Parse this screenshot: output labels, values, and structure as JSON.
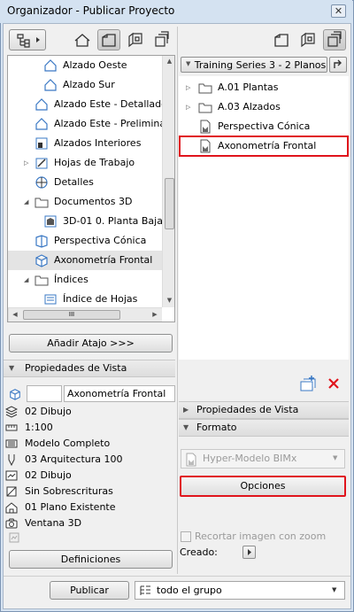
{
  "window": {
    "title": "Organizador - Publicar Proyecto",
    "close": "✕"
  },
  "left_tree": {
    "items": [
      {
        "label": "Alzado Oeste",
        "icon": "elevation-icon"
      },
      {
        "label": "Alzado Sur",
        "icon": "elevation-icon"
      },
      {
        "label": "Alzado Este - Detallado",
        "icon": "elevation-icon"
      },
      {
        "label": "Alzado Este - Preliminar",
        "icon": "elevation-icon"
      },
      {
        "label": "Alzados Interiores",
        "icon": "interior-elevation-icon"
      },
      {
        "label": "Hojas de Trabajo",
        "icon": "worksheet-icon"
      },
      {
        "label": "Detalles",
        "icon": "detail-icon"
      },
      {
        "label": "Documentos 3D",
        "icon": "folder-icon"
      },
      {
        "label": "3D-01 0. Planta Baja",
        "icon": "document-3d-icon"
      },
      {
        "label": "Perspectiva Cónica",
        "icon": "perspective-icon"
      },
      {
        "label": "Axonometría Frontal",
        "icon": "axonometry-icon"
      },
      {
        "label": "Índices",
        "icon": "folder-icon"
      },
      {
        "label": "Índice de Hojas",
        "icon": "index-icon"
      }
    ],
    "hscroll_thumb": "III"
  },
  "add_shortcut": "Añadir Atajo >>>",
  "view_props": {
    "header": "Propiedades de Vista",
    "name_value": "Axonometría Frontal",
    "rows": [
      "02 Dibujo",
      "1:100",
      "Modelo Completo",
      "03 Arquitectura 100",
      "02 Dibujo",
      "Sin Sobrescrituras",
      "01 Plano Existente",
      "Ventana 3D"
    ],
    "definitions_btn": "Definiciones"
  },
  "right": {
    "set_dropdown": "Training Series 3 - 2 Planos",
    "tree": [
      "A.01 Plantas",
      "A.03 Alzados",
      "Perspectiva Cónica",
      "Axonometría Frontal"
    ],
    "props_header": "Propiedades de Vista",
    "format_header": "Formato",
    "format_select": "Hyper-Modelo BIMx",
    "options_btn": "Opciones",
    "crop_label": "Recortar imagen con zoom",
    "created_label": "Creado:"
  },
  "bottom": {
    "publish_btn": "Publicar",
    "group_select": "todo el grupo"
  },
  "colors": {
    "highlight": "#e0141c",
    "accent_blue": "#3a78c4"
  }
}
